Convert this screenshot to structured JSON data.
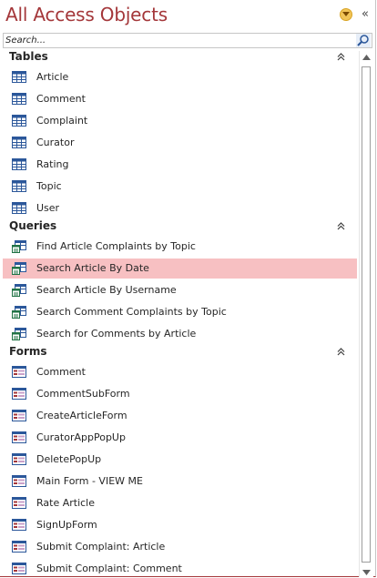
{
  "header": {
    "title": "All Access Objects"
  },
  "search": {
    "placeholder": "Search..."
  },
  "colors": {
    "accent": "#a4373a",
    "selected": "#f7c0c2"
  },
  "groups": [
    {
      "label": "Tables",
      "icon": "table-icon",
      "items": [
        "Article",
        "Comment",
        "Complaint",
        "Curator",
        "Rating",
        "Topic",
        "User"
      ]
    },
    {
      "label": "Queries",
      "icon": "query-icon",
      "items": [
        "Find Article Complaints by Topic",
        "Search Article By Date",
        "Search Article By Username",
        "Search Comment Complaints by Topic",
        "Search for Comments by Article"
      ]
    },
    {
      "label": "Forms",
      "icon": "form-icon",
      "items": [
        "Comment",
        "CommentSubForm",
        "CreateArticleForm",
        "CuratorAppPopUp",
        "DeletePopUp",
        "Main Form - VIEW ME",
        "Rate Article",
        "SignUpForm",
        "Submit Complaint: Article",
        "Submit Complaint: Comment"
      ]
    }
  ],
  "selected_item": "Search Article By Date"
}
